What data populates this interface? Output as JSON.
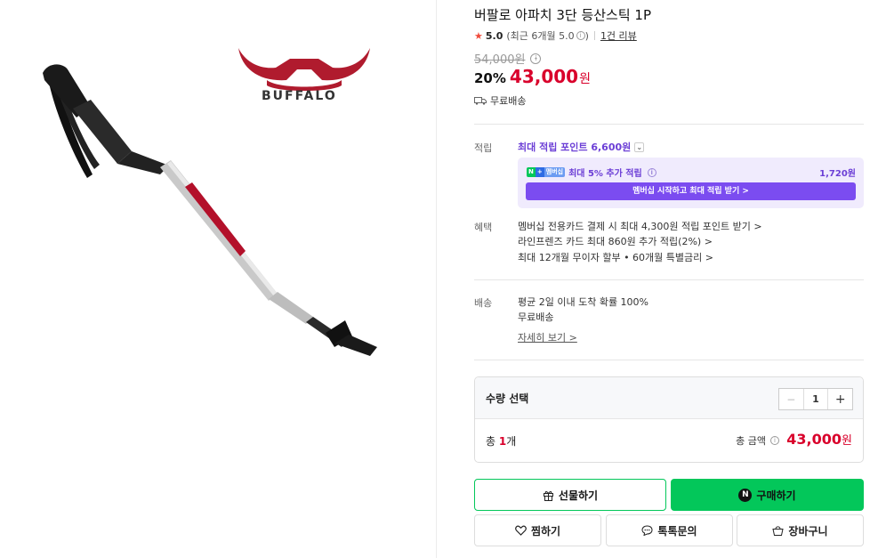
{
  "product": {
    "title": "버팔로 아파치 3단 등산스틱 1P",
    "brand_logo_text": "BUFFALO",
    "rating_score": "5.0",
    "rating_recent": "(최근 6개월 5.0",
    "rating_recent_close": ")",
    "review_count": "1건 리뷰",
    "original_price": "54,000원",
    "discount": "20%",
    "price": "43,000",
    "price_unit": "원",
    "shipping": "무료배송"
  },
  "points": {
    "label": "적립",
    "max_points": "최대 적립 포인트 6,600원",
    "member_badge": {
      "n": "N",
      "plus": "+",
      "ms": "멤버십"
    },
    "member_text": "최대 5% 추가 적립",
    "member_amount": "1,720원",
    "member_button": "멤버십 시작하고 최대 적립 받기 >"
  },
  "benefits": {
    "label": "혜택",
    "items": [
      "멤버십 전용카드 결제 시 최대 4,300원 적립 포인트 받기 >",
      "라인프렌즈 카드 최대 860원 추가 적립(2%) >",
      "최대 12개월 무이자 할부 • 60개월 특별금리 >"
    ]
  },
  "delivery": {
    "label": "배송",
    "lines": [
      "평균 2일 이내 도착 확률 100%",
      "무료배송"
    ],
    "detail_link": "자세히 보기 >"
  },
  "quantity": {
    "title": "수량 선택",
    "minus": "−",
    "value": "1",
    "plus": "+",
    "total_prefix": "총 ",
    "total_count": "1",
    "total_suffix": "개",
    "total_label": "총 금액",
    "total_price": "43,000",
    "total_unit": "원"
  },
  "buttons": {
    "gift": "선물하기",
    "buy": "구매하기",
    "buy_badge": "N",
    "wish": "찜하기",
    "talk": "톡톡문의",
    "cart": "장바구니"
  },
  "icons": {
    "star": "star-icon",
    "info": "info-icon",
    "truck": "truck-icon",
    "gift": "gift-icon",
    "heart": "heart-icon",
    "chat": "chat-icon",
    "cart": "cart-icon"
  },
  "colors": {
    "price_red": "#d9002b",
    "naver_green": "#03c75a",
    "membership_purple": "#6c3fd6"
  }
}
